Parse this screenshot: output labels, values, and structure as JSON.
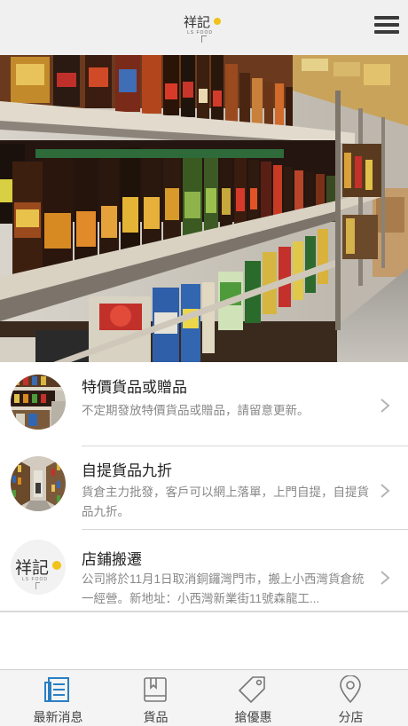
{
  "header": {
    "logo_main": "祥記",
    "logo_sub": "LS FOOD",
    "menu_icon": "hamburger-menu-icon"
  },
  "banner": {
    "image": "store-shelves-photo"
  },
  "items": [
    {
      "title": "特價貨品或贈品",
      "desc": "不定期發放特價貨品或贈品，請留意更新。",
      "thumb": "store-shelves-thumb"
    },
    {
      "title": "自提貨品九折",
      "desc": "貨倉主力批發，客戶可以網上落單，上門自提，自提貨品九折。",
      "thumb": "warehouse-aisle-thumb"
    },
    {
      "title": "店鋪搬遷",
      "desc": "公司將於11月1日取消銅鑼灣門市，搬上小西灣貨倉統一經營。新地址：小西灣新業街11號森龍工...",
      "thumb": "logo-thumb",
      "thumb_logo": "祥記",
      "thumb_logo_sub": "LS FOOD"
    }
  ],
  "tabs": [
    {
      "label": "最新消息",
      "icon": "news-icon",
      "active": true
    },
    {
      "label": "貨品",
      "icon": "book-icon",
      "active": false
    },
    {
      "label": "搶優惠",
      "icon": "tag-icon",
      "active": false
    },
    {
      "label": "分店",
      "icon": "location-pin-icon",
      "active": false
    }
  ],
  "colors": {
    "accent": "#2a7fc4",
    "logo_yellow": "#f2c21b",
    "header_bg": "#f0f0f0",
    "tabbar_bg": "#f4f4f4"
  }
}
